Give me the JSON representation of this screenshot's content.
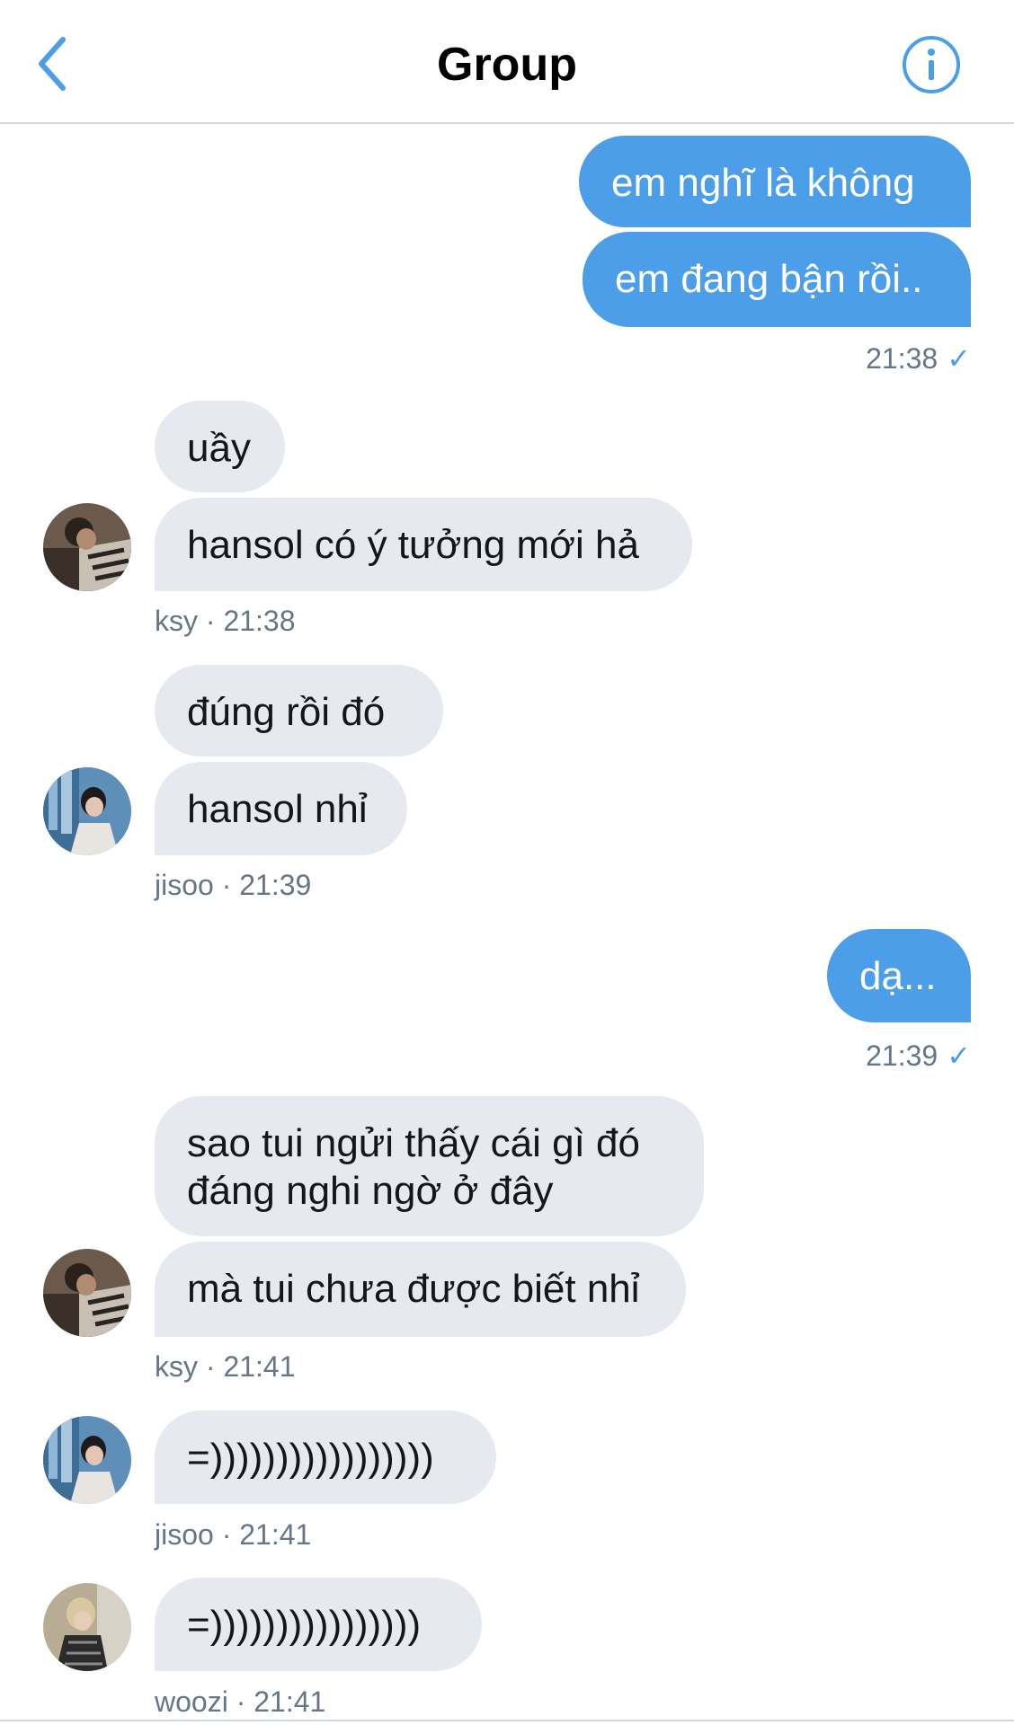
{
  "header": {
    "title": "Group",
    "back_icon": "chevron-left-icon",
    "info_icon": "info-circle-icon"
  },
  "colors": {
    "accent": "#4c9ee8",
    "incoming_bubble": "#e6e9ef",
    "meta_text": "#657786"
  },
  "messages": {
    "m1": "em nghĩ là không",
    "m2": "em đang bận rồi..",
    "t1": "21:38",
    "m3": "uầy",
    "m4": "hansol có ý tưởng mới hả",
    "s1": "ksy · 21:38",
    "m5": "đúng rồi đó",
    "m6": "hansol nhỉ",
    "s2": "jisoo · 21:39",
    "m7": "dạ...",
    "t2": "21:39",
    "m8": "sao tui ngửi thấy cái gì đó đáng nghi ngờ ở đây",
    "m9": "mà tui chưa được biết nhỉ",
    "s3": "ksy · 21:41",
    "m10": "=)))))))))))))))))",
    "s4": "jisoo · 21:41",
    "m11": "=))))))))))))))))",
    "s5": "woozi · 21:41"
  },
  "read_icon": "checkmark-icon",
  "check_glyph": "✓"
}
